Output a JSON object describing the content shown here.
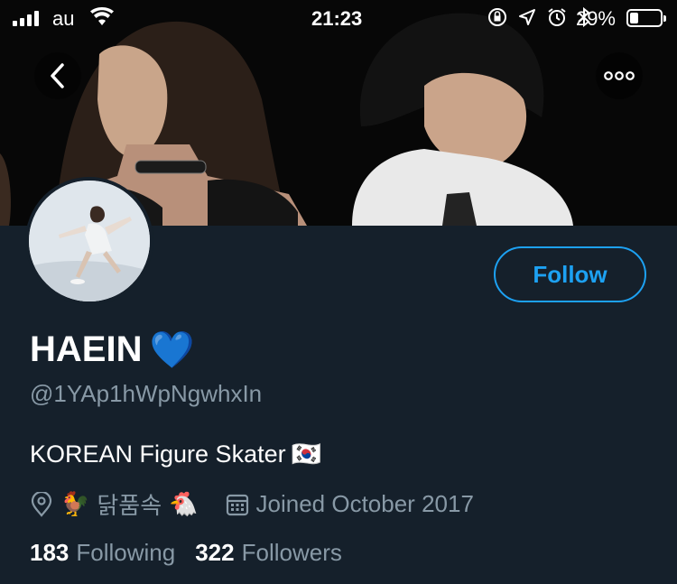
{
  "status_bar": {
    "carrier": "au",
    "time": "21:23",
    "battery_percent": "29%"
  },
  "profile": {
    "display_name": "HAEIN",
    "name_emoji": "💙",
    "handle": "@1YAp1hWpNgwhxIn",
    "bio": "KOREAN Figure Skater",
    "bio_flag": "🇰🇷",
    "location_prefix": "🐓",
    "location": "닭품속",
    "location_suffix": "🐔",
    "joined": "Joined October 2017",
    "following_count": "183",
    "following_label": "Following",
    "followers_count": "322",
    "followers_label": "Followers"
  },
  "actions": {
    "follow_label": "Follow"
  },
  "icons": {
    "back": "chevron-left-icon",
    "more": "more-horizontal-icon",
    "location": "location-pin-icon",
    "calendar": "calendar-icon"
  },
  "colors": {
    "background": "#15202b",
    "accent": "#1da1f2",
    "secondary_text": "#8899a6"
  }
}
